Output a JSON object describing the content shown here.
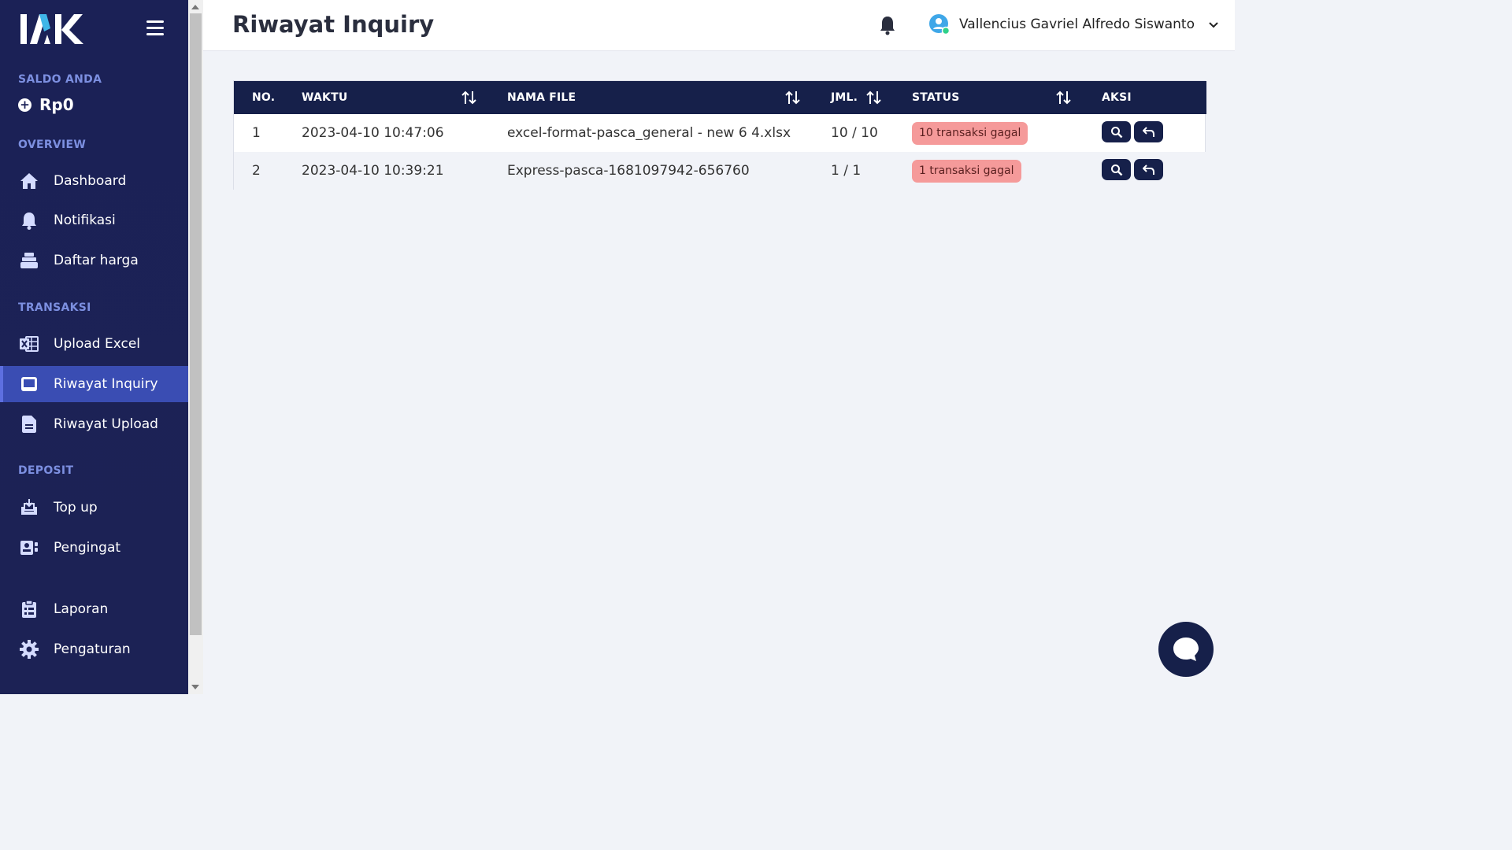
{
  "app": {
    "logo_text": "IAK",
    "page_title": "Riwayat Inquiry"
  },
  "sidebar": {
    "saldo_label": "SALDO ANDA",
    "saldo_value": "Rp0",
    "sections": {
      "overview": "OVERVIEW",
      "transaksi": "TRANSAKSI",
      "deposit": "DEPOSIT"
    },
    "items": [
      {
        "label": "Dashboard",
        "icon": "home-icon"
      },
      {
        "label": "Notifikasi",
        "icon": "bell-icon"
      },
      {
        "label": "Daftar harga",
        "icon": "stack-icon"
      },
      {
        "label": "Upload Excel",
        "icon": "excel-icon"
      },
      {
        "label": "Riwayat Inquiry",
        "icon": "inbox-icon",
        "active": true
      },
      {
        "label": "Riwayat Upload",
        "icon": "document-icon"
      },
      {
        "label": "Top up",
        "icon": "download-tray-icon"
      },
      {
        "label": "Pengingat",
        "icon": "contact-card-icon"
      },
      {
        "label": "Laporan",
        "icon": "clipboard-icon"
      },
      {
        "label": "Pengaturan",
        "icon": "gear-icon"
      }
    ]
  },
  "header": {
    "user_name": "Vallencius Gavriel Alfredo Siswanto"
  },
  "table": {
    "columns": [
      "NO.",
      "WAKTU",
      "NAMA FILE",
      "JML.",
      "STATUS",
      "AKSI"
    ],
    "rows": [
      {
        "no": "1",
        "waktu": "2023-04-10 10:47:06",
        "nama_file": "excel-format-pasca_general - new 6 4.xlsx",
        "jml": "10 / 10",
        "status": "10 transaksi gagal"
      },
      {
        "no": "2",
        "waktu": "2023-04-10 10:39:21",
        "nama_file": "Express-pasca-1681097942-656760",
        "jml": "1 / 1",
        "status": "1 transaksi gagal"
      }
    ]
  },
  "colors": {
    "sidebar_bg": "#1b2156",
    "active_item": "#3a4db3",
    "table_header": "#16204a",
    "badge_bg": "#f59a9a",
    "section_label": "#7c8fe0"
  }
}
